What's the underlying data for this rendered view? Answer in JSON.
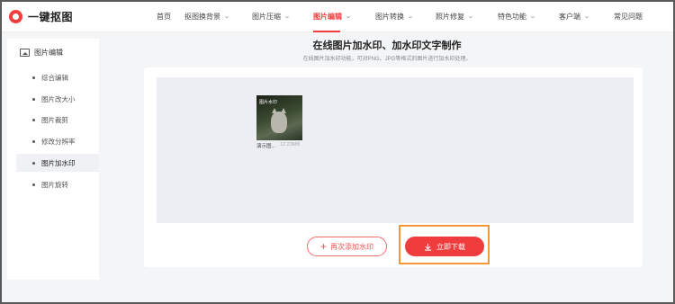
{
  "app": {
    "name": "一键抠图"
  },
  "nav": [
    {
      "label": "首页",
      "dropdown": false
    },
    {
      "label": "抠图换背景",
      "dropdown": true
    },
    {
      "label": "图片压缩",
      "dropdown": true
    },
    {
      "label": "图片编辑",
      "dropdown": true,
      "active": true
    },
    {
      "label": "图片转换",
      "dropdown": true
    },
    {
      "label": "照片修复",
      "dropdown": true
    },
    {
      "label": "特色功能",
      "dropdown": true
    },
    {
      "label": "客户端",
      "dropdown": true
    },
    {
      "label": "常见问题",
      "dropdown": false
    }
  ],
  "sidebar": {
    "title": "图片编辑",
    "items": [
      {
        "label": "综合编辑"
      },
      {
        "label": "图片改大小"
      },
      {
        "label": "图片裁剪"
      },
      {
        "label": "修改分辨率"
      },
      {
        "label": "图片加水印",
        "active": true
      },
      {
        "label": "图片旋转"
      }
    ]
  },
  "main": {
    "title": "在线图片加水印、加水印文字制作",
    "subtitle": "在线图片加水印功能，可对PNG、JPG等格式的图片进行加水印处理。",
    "file": {
      "name": "演示图...",
      "size": "12.23MB",
      "watermark_text": "图片水印"
    },
    "add_button": "再次添加水印",
    "download_button": "立即下载"
  },
  "colors": {
    "accent": "#f03c3c",
    "highlight": "#f29a3a"
  }
}
